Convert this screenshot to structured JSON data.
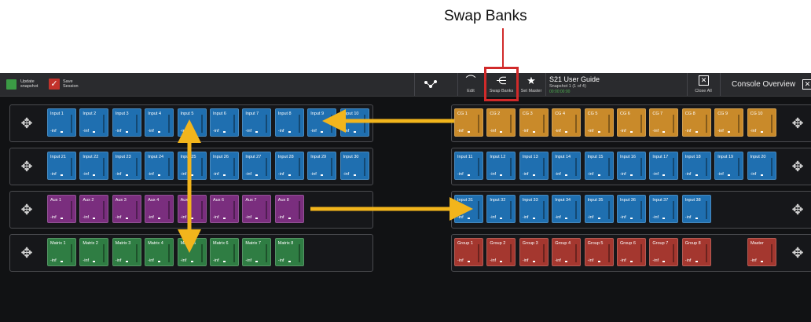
{
  "callout": {
    "label": "Swap Banks"
  },
  "toolbar": {
    "update_snapshot": "Update\nsnapshot",
    "save_session": "Save\nSession",
    "edit": "Edit",
    "swap_banks": "Swap Banks",
    "set_master": "Set Master",
    "session_title": "S21 User Guide",
    "session_subtitle": "Snapshot 1 (1 of 4)",
    "session_status": "00:00:00:00",
    "close_all": "Close All",
    "view_title": "Console Overview"
  },
  "level_text": "-inf",
  "colors": {
    "input": "#1f6fb0",
    "cg": "#c98a2a",
    "aux": "#7a2e7e",
    "matrix": "#2f7d43",
    "group": "#a4372f",
    "arrow": "#f2b51c",
    "highlight": "#d12a2a"
  },
  "left_rows": [
    [
      "Input 1",
      "Input 2",
      "Input 3",
      "Input 4",
      "Input 5",
      "Input 6",
      "Input 7",
      "Input 8",
      "Input 9",
      "Input 10"
    ],
    [
      "Input 21",
      "Input 22",
      "Input 23",
      "Input 24",
      "Input 25",
      "Input 26",
      "Input 27",
      "Input 28",
      "Input 29",
      "Input 30"
    ],
    [
      "Aux 1",
      "Aux 2",
      "Aux 3",
      "Aux 4",
      "Aux 5",
      "Aux 6",
      "Aux 7",
      "Aux 8"
    ],
    [
      "Matrix 1",
      "Matrix 2",
      "Matrix 3",
      "Matrix 4",
      "Matrix 5",
      "Matrix 6",
      "Matrix 7",
      "Matrix 8"
    ]
  ],
  "right_rows": [
    [
      "CG 1",
      "CG 2",
      "CG 3",
      "CG 4",
      "CG 5",
      "CG 6",
      "CG 7",
      "CG 8",
      "CG 9",
      "CG 10"
    ],
    [
      "Input 11",
      "Input 12",
      "Input 13",
      "Input 14",
      "Input 15",
      "Input 16",
      "Input 17",
      "Input 18",
      "Input 19",
      "Input 20"
    ],
    [
      "Input 31",
      "Input 32",
      "Input 33",
      "Input 34",
      "Input 35",
      "Input 36",
      "Input 37",
      "Input 38"
    ],
    [
      "Group 1",
      "Group 2",
      "Group 3",
      "Group 4",
      "Group 5",
      "Group 6",
      "Group 7",
      "Group 8",
      "Master"
    ]
  ]
}
